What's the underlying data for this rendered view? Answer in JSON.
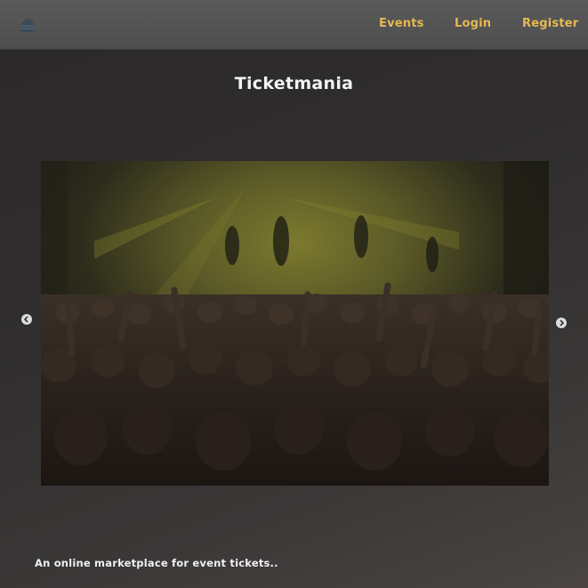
{
  "nav": {
    "home_icon": "home-icon",
    "links": [
      "Events",
      "Login",
      "Register"
    ]
  },
  "hero": {
    "title": "Ticketmania"
  },
  "carousel": {
    "prev_icon": "chevron-left-icon",
    "next_icon": "chevron-right-icon",
    "slide_description": "concert-crowd-photo"
  },
  "footer": {
    "tagline": "An online marketplace for event tickets.."
  },
  "colors": {
    "accent": "#e8b850",
    "navbar": "#555555",
    "background": "#2f2d2d"
  }
}
